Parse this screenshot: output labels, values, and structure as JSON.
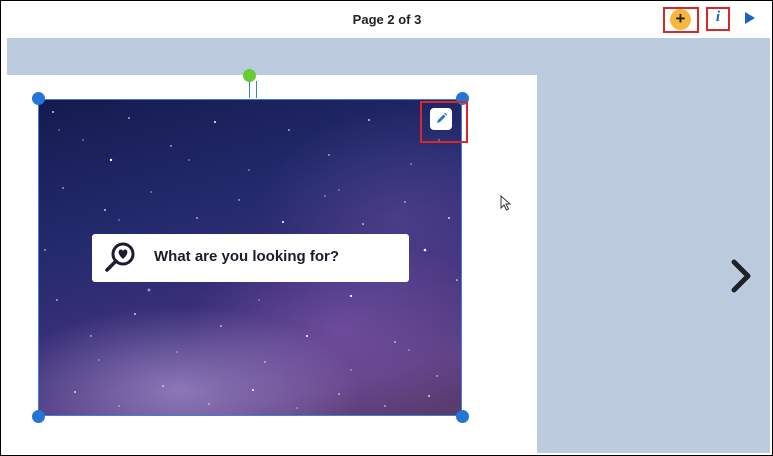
{
  "header": {
    "page_indicator": "Page 2 of 3",
    "add_label": "+",
    "info_label": "i",
    "icons": [
      "add-icon",
      "info-icon",
      "play-icon"
    ]
  },
  "image_block": {
    "search_text": "What are you looking for?",
    "icons": [
      "magnifier-heart-icon",
      "pencil-icon"
    ]
  },
  "navigation": {
    "next_icon": "chevron-right-icon"
  },
  "colors": {
    "accent_blue": "#2476d6",
    "highlight_red": "#d62828",
    "add_yellow": "#f6b73c",
    "rotate_green": "#66cc33",
    "canvas_bg": "#bccbdd"
  }
}
